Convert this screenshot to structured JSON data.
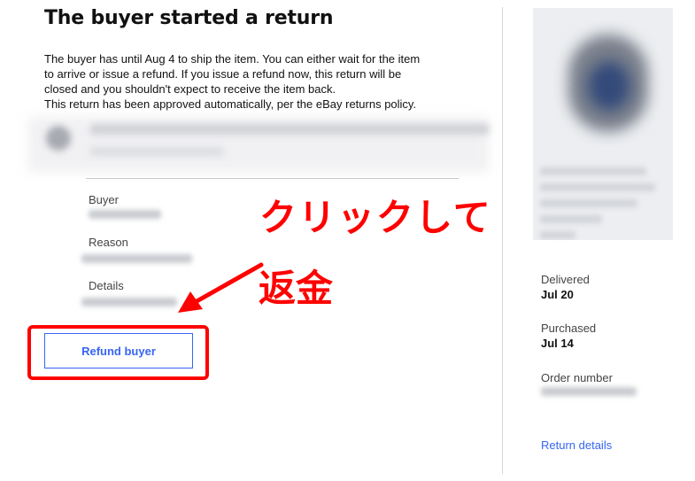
{
  "main": {
    "title": "The buyer started a return",
    "description": [
      "The buyer has until Aug 4 to ship the item. You can either wait for the item",
      "to arrive or issue a refund. If you issue a refund now, this return will be",
      "closed and you shouldn't expect to receive the item back.",
      "This return has been approved automatically, per the eBay returns policy."
    ],
    "fields": {
      "buyer_label": "Buyer",
      "reason_label": "Reason",
      "details_label": "Details"
    },
    "refund_button_label": "Refund buyer"
  },
  "annotations": {
    "click_text": "クリックして",
    "refund_text": "返金",
    "color": "#ff0000"
  },
  "sidebar": {
    "delivered_label": "Delivered",
    "delivered_value": "Jul 20",
    "purchased_label": "Purchased",
    "purchased_value": "Jul 14",
    "order_number_label": "Order number",
    "return_details_link": "Return details"
  },
  "colors": {
    "link": "#3665f3",
    "highlight": "#ff0000"
  }
}
